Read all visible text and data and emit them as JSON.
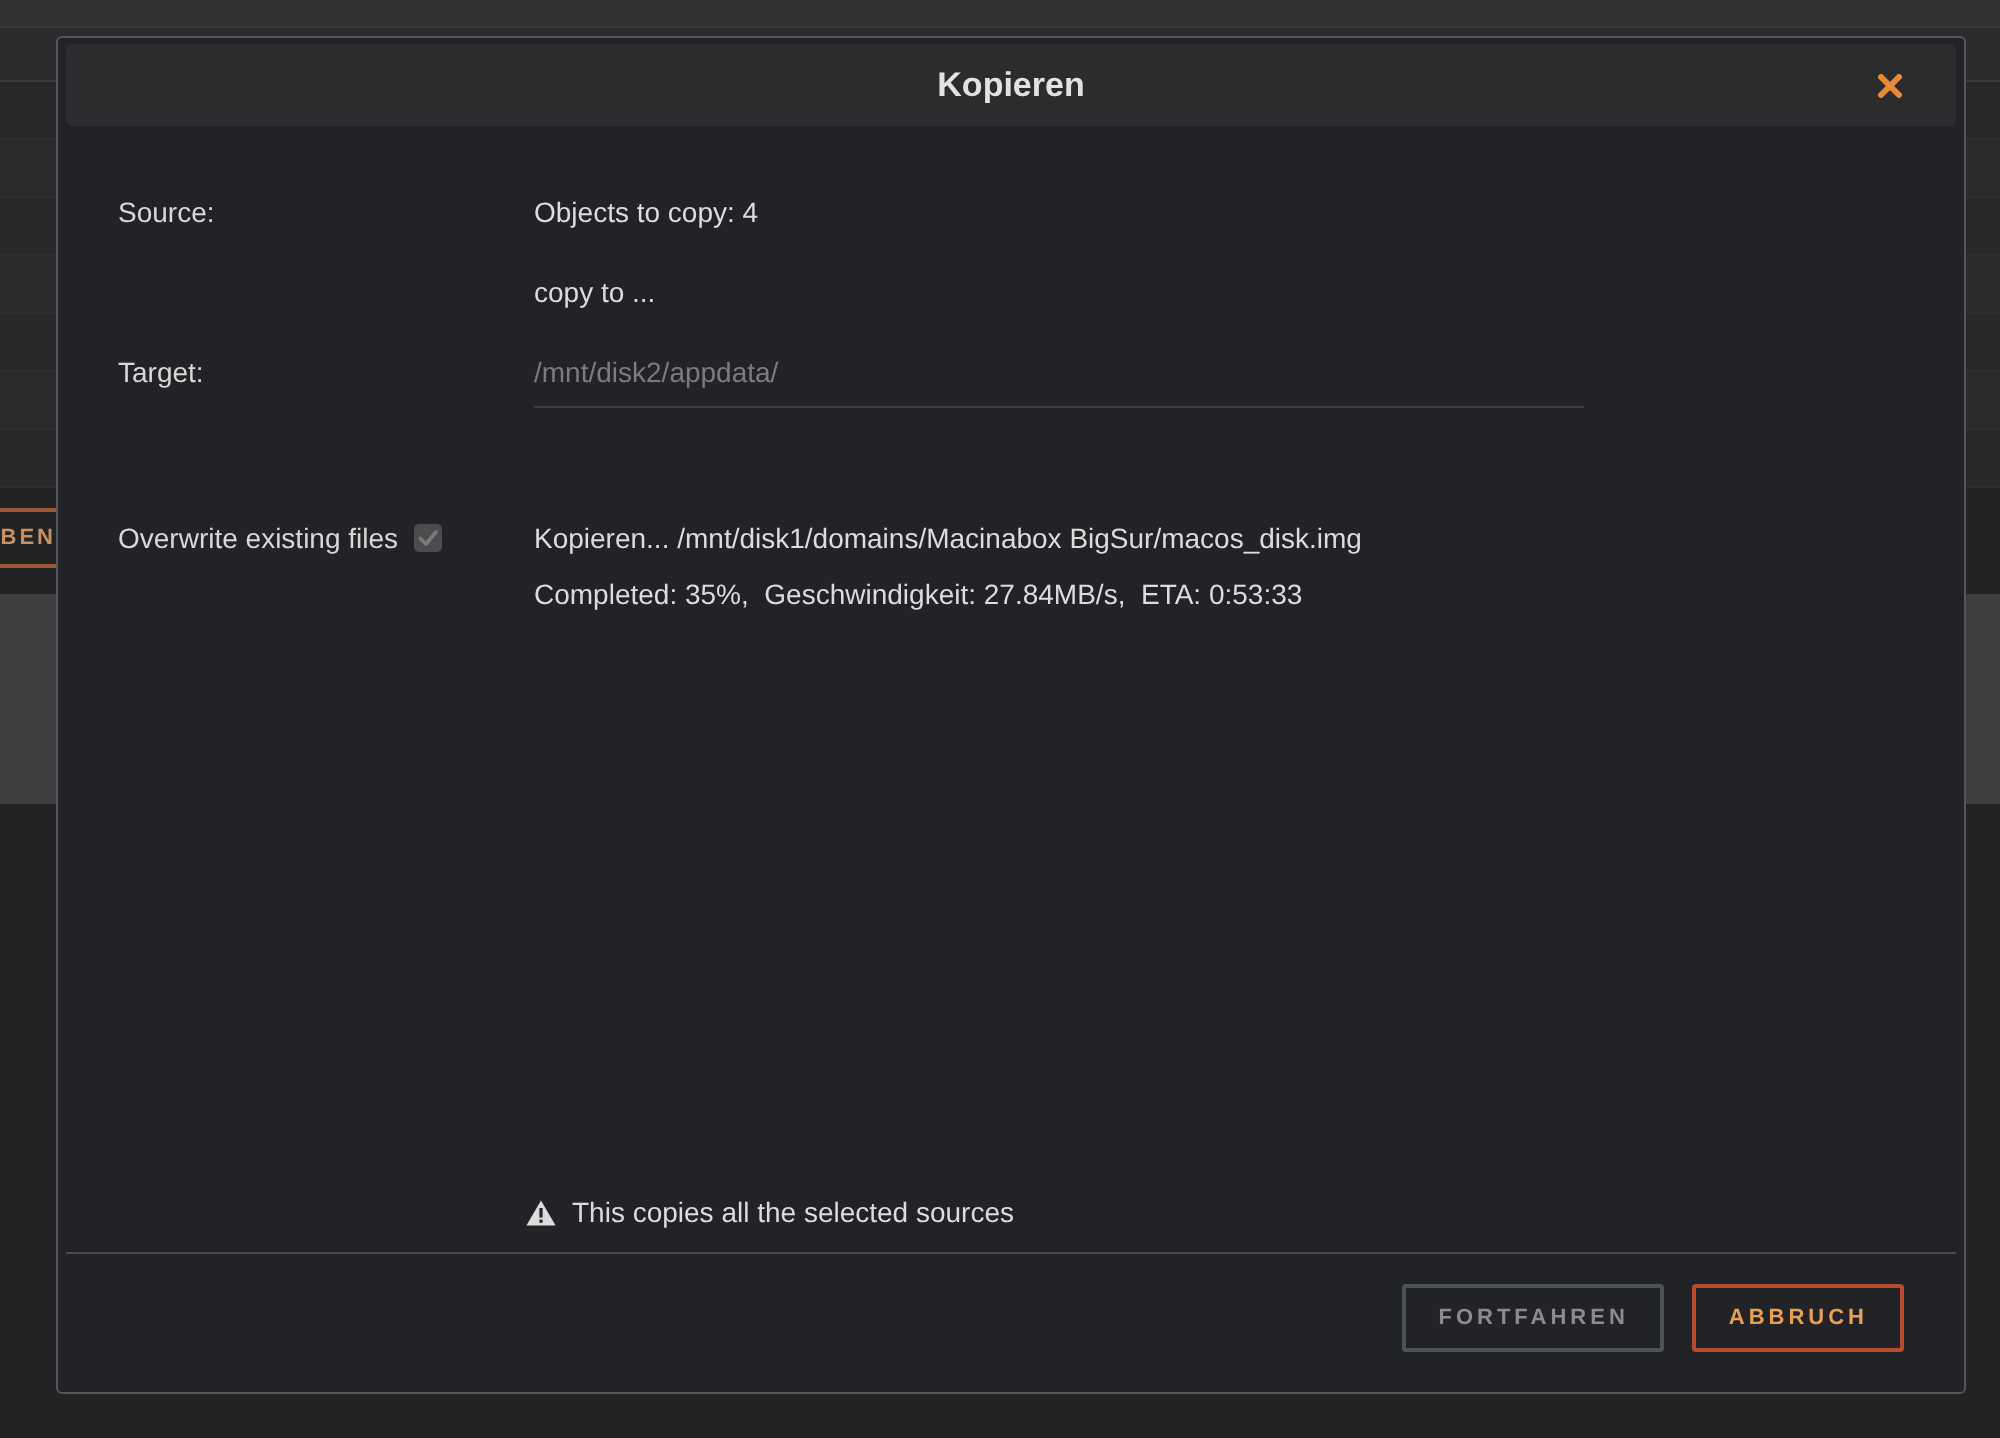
{
  "background": {
    "button_label": "BEN"
  },
  "dialog": {
    "title": "Kopieren"
  },
  "fields": [
    {
      "kind": "text",
      "label": "Source:",
      "value": "Objects to copy: 4"
    },
    {
      "kind": "note",
      "value": "copy to ..."
    },
    {
      "kind": "input",
      "label": "Target:",
      "placeholder": "/mnt/disk2/appdata/"
    }
  ],
  "overwrite": {
    "label": "Overwrite existing files",
    "checked": true,
    "disabled": true
  },
  "progress": [
    "Kopieren... /mnt/disk1/domains/Macinabox BigSur/macos_disk.img",
    "Completed: 35%,  Geschwindigkeit: 27.84MB/s,  ETA: 0:53:33"
  ],
  "notice": "This copies all the selected sources",
  "buttons": [
    {
      "label": "FORTFAHREN",
      "disabled": true
    },
    {
      "label": "ABBRUCH",
      "disabled": false
    }
  ]
}
